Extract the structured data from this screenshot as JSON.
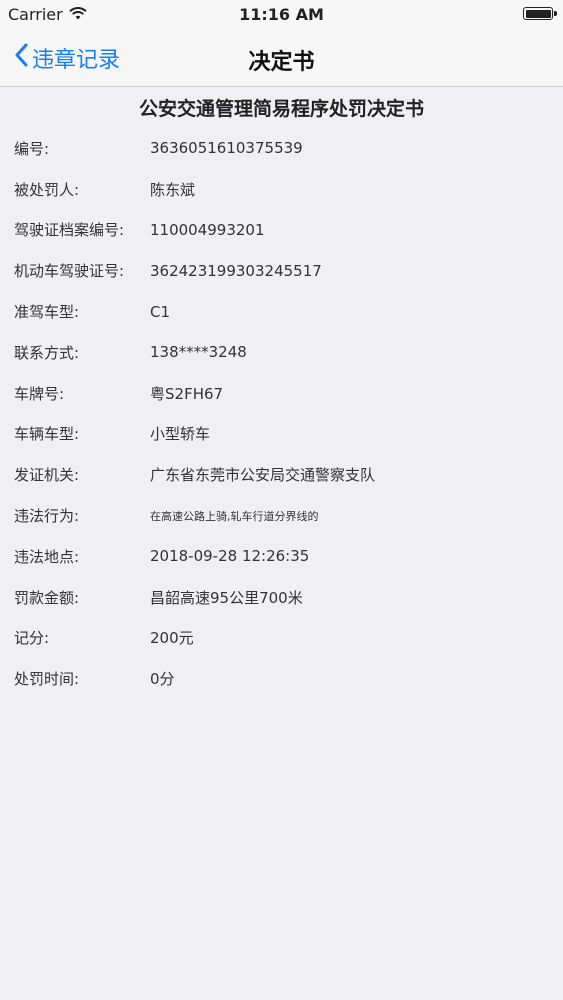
{
  "status_bar": {
    "carrier": "Carrier",
    "time": "11:16 AM"
  },
  "nav": {
    "back_label": "违章记录",
    "title": "决定书"
  },
  "document": {
    "title": "公安交通管理简易程序处罚决定书",
    "fields": [
      {
        "label": "编号:",
        "value": "3636051610375539"
      },
      {
        "label": "被处罚人:",
        "value": "陈东斌"
      },
      {
        "label": "驾驶证档案编号:",
        "value": "110004993201"
      },
      {
        "label": "机动车驾驶证号:",
        "value": "362423199303245517"
      },
      {
        "label": "准驾车型:",
        "value": "C1"
      },
      {
        "label": "联系方式:",
        "value": "138****3248"
      },
      {
        "label": "车牌号:",
        "value": "粤S2FH67"
      },
      {
        "label": "车辆车型:",
        "value": "小型轿车"
      },
      {
        "label": "发证机关:",
        "value": "广东省东莞市公安局交通警察支队"
      },
      {
        "label": "违法行为:",
        "value": "在高速公路上骑,轧车行道分界线的"
      },
      {
        "label": "违法地点:",
        "value": "2018-09-28 12:26:35"
      },
      {
        "label": "罚款金额:",
        "value": "昌韶高速95公里700米"
      },
      {
        "label": "记分:",
        "value": "200元"
      },
      {
        "label": "处罚时间:",
        "value": "0分"
      }
    ]
  },
  "colors": {
    "accent": "#147efb",
    "background": "#efeff4",
    "bar": "#f7f7f7"
  }
}
